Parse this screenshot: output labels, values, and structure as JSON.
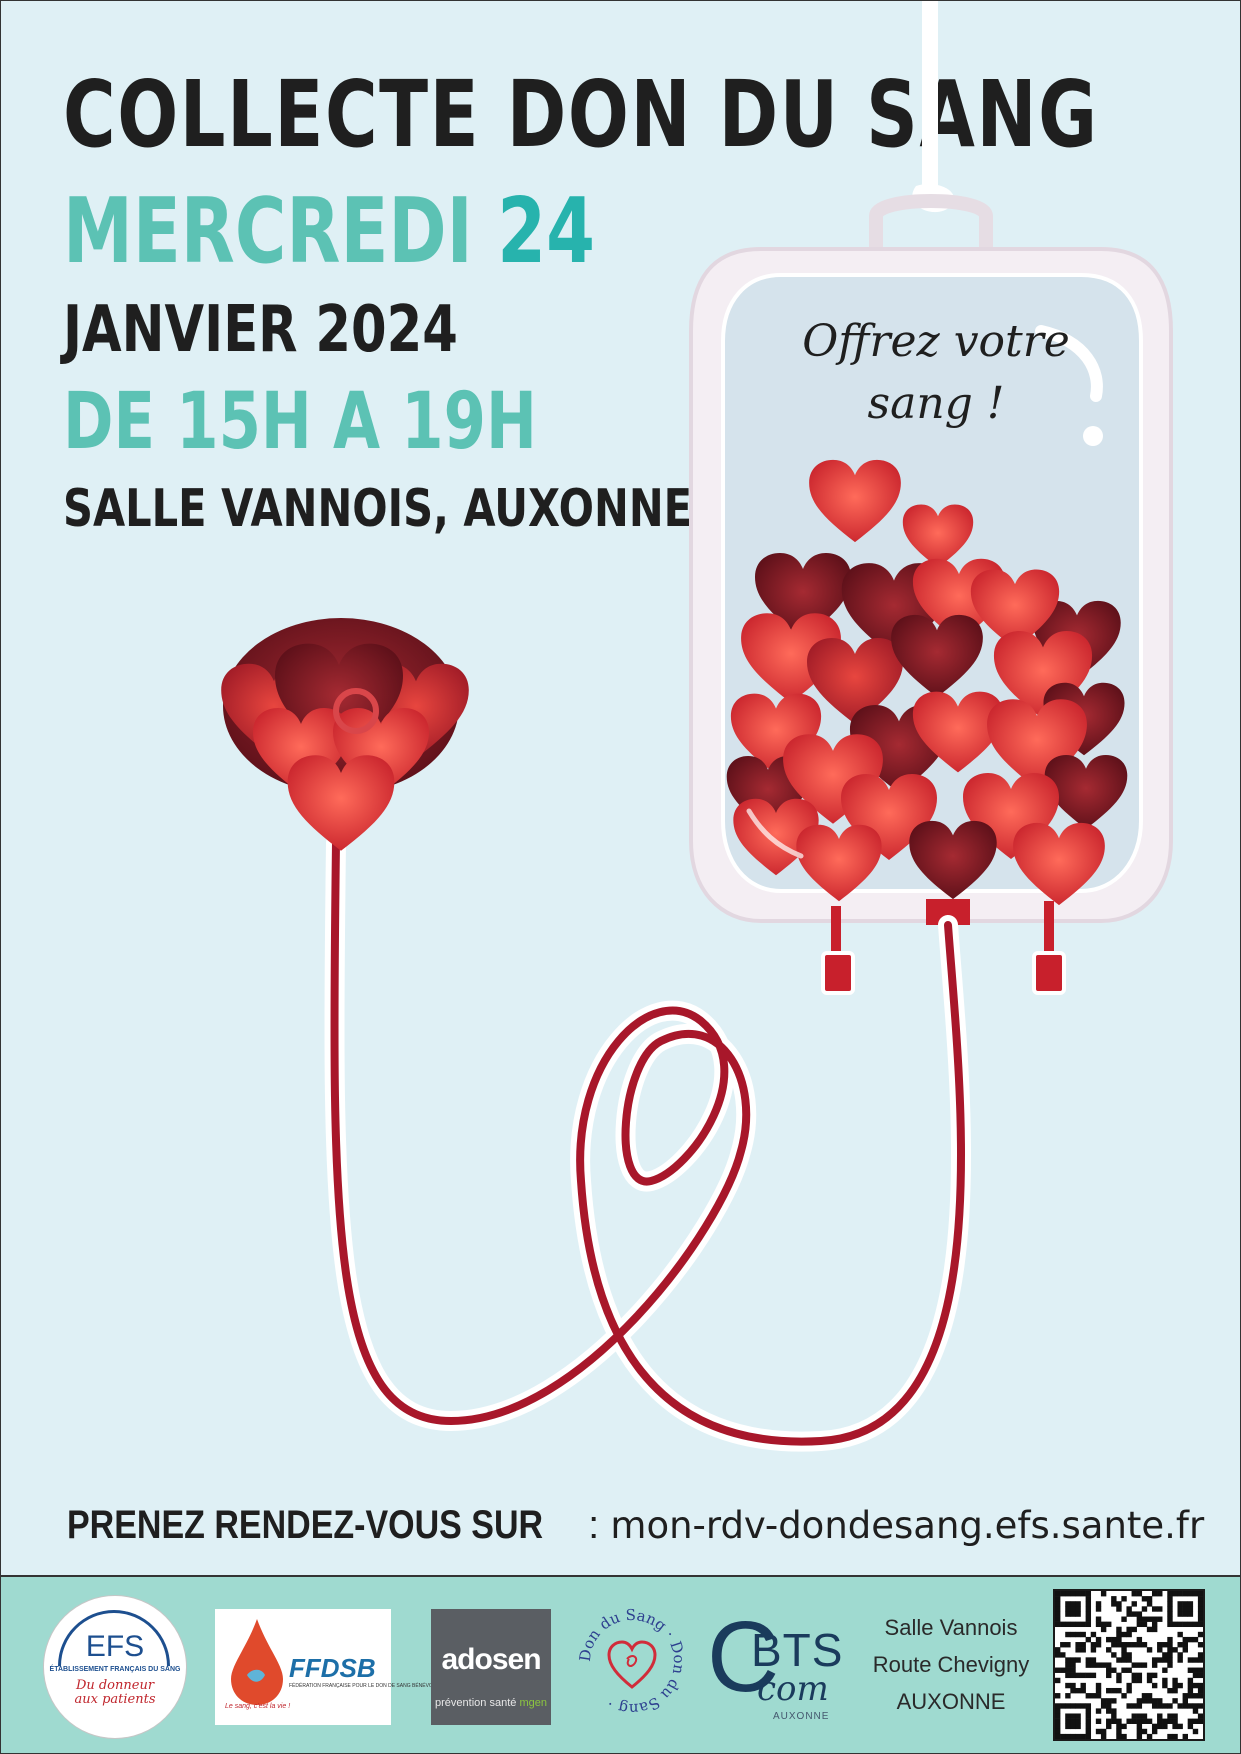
{
  "headline": {
    "title": "COLLECTE DON DU SANG",
    "day_name": "MERCREDI",
    "day_number": "24",
    "month_year": "JANVIER 2024",
    "hours": "DE 15H A 19H",
    "place": "SALLE VANNOIS, AUXONNE"
  },
  "bag": {
    "line1": "Offrez votre",
    "line2": "sang !"
  },
  "appointment": {
    "label": "PRENEZ RENDEZ-VOUS SUR",
    "separator": " : ",
    "url": "mon-rdv-dondesang.efs.sante.fr"
  },
  "footer": {
    "efs": {
      "name": "EFS",
      "subtitle": "ÉTABLISSEMENT FRANÇAIS DU SANG",
      "tagline_1": "Du donneur",
      "tagline_2": "aux patients"
    },
    "ffdsb": {
      "name": "FFDSB",
      "subtitle": "FÉDÉRATION FRANÇAISE POUR LE DON DE SANG BÉNÉVOLE",
      "motto": "Le sang, c'est la vie !"
    },
    "adosen": {
      "name": "adosen",
      "subtitle": "prévention santé",
      "subtitle_brand": "mgen"
    },
    "don_du_sang": {
      "text": "Don du Sang · Don du Sang ·"
    },
    "bts": {
      "name": "BTS",
      "com": "com",
      "town": "AUXONNE"
    },
    "address": {
      "line1": "Salle Vannois",
      "line2": "Route Chevigny",
      "line3": "AUXONNE"
    }
  },
  "colors": {
    "background": "#dff0f5",
    "teal": "#5cc2b4",
    "dark_teal": "#27b3ad",
    "blood": "#a8172a",
    "footer": "#9fdad0"
  }
}
